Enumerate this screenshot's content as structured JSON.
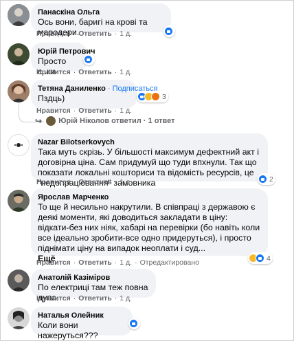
{
  "comments": [
    {
      "author": "Панаскіна Ольга",
      "text": "Ось вони, баригі на крові та мародери.",
      "actions": {
        "like": "Нравится",
        "reply": "Ответить",
        "time": "1 д."
      },
      "reactions": {
        "icons": [
          "like-icon"
        ],
        "count": ""
      }
    },
    {
      "author": "Юрій Петрович",
      "text": "Просто с..ки",
      "actions": {
        "like": "Нравится",
        "reply": "Ответить",
        "time": "1 д."
      },
      "reactions": {
        "icons": [
          "like-icon"
        ],
        "count": ""
      }
    },
    {
      "author": "Тетяна Даниленко",
      "follow": "Подписаться",
      "follow_separator": "·",
      "text": "Пздць)",
      "actions": {
        "like": "Нравится",
        "reply": "Ответить",
        "time": "1 д."
      },
      "reactions": {
        "icons": [
          "like-icon",
          "haha-icon",
          "angry-icon"
        ],
        "count": "3"
      },
      "replies_link": "Юрій Ніколов ответил · 1 ответ"
    },
    {
      "author": "Nazar Bilotserkovych",
      "text": "Така муть скрізь. У більшості максимум дефектний акт і договірна ціна. Сам придумуй що туди впхнули. Так що показати локальні кошториси та відомість ресурсів, це \"недопрацювання\" замовника",
      "actions": {
        "like": "Нравится",
        "reply": "Ответить",
        "time": "1 д."
      },
      "reactions": {
        "icons": [
          "like-icon"
        ],
        "count": "2"
      }
    },
    {
      "author": "Ярослав Марченко",
      "text": "То ще й несильно накрутили. В співпраці з державою є деякі моменти, які доводиться закладати в ціну: відкати-без них ніяк, хабарі на перевірки (бо навіть коли все ідеально зробити-все одно придеруться), і просто піднімати ціну на випадок неоплати і суд...",
      "more": "Ещё",
      "actions": {
        "like": "Нравится",
        "reply": "Ответить",
        "time": "1 д.",
        "edited": "Отредактировано"
      },
      "reactions": {
        "icons": [
          "sad-icon",
          "like-icon"
        ],
        "count": "4"
      }
    },
    {
      "author": "Анатолій Казіміров",
      "text": "По електриці там теж повна дупа.",
      "actions": {
        "like": "Нравится",
        "reply": "Ответить",
        "time": "1 д."
      }
    },
    {
      "author": "Наталья Олейник",
      "text": "Коли вони нажеруться???",
      "reactions": {
        "icons": [
          "like-icon"
        ],
        "count": ""
      }
    }
  ],
  "colors": {
    "bubble": "#f0f2f5",
    "meta": "#65676b",
    "link": "#1877f2",
    "like": "#1877f2",
    "haha": "#f7b928",
    "angry": "#e9710f"
  }
}
